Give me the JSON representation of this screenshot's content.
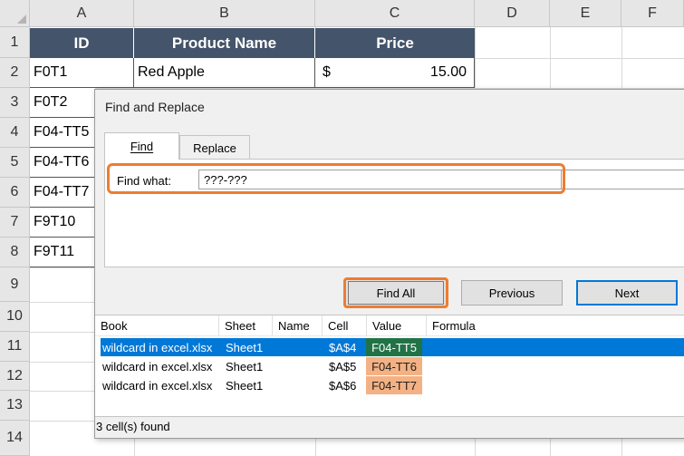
{
  "sheet": {
    "columns": [
      "A",
      "B",
      "C",
      "D",
      "E",
      "F"
    ],
    "rows": [
      "1",
      "2",
      "3",
      "4",
      "5",
      "6",
      "7",
      "8",
      "9",
      "10",
      "11",
      "12",
      "13",
      "14"
    ],
    "headers": {
      "id": "ID",
      "product": "Product Name",
      "price": "Price"
    },
    "row2": {
      "id": "F0T1",
      "product": "Red Apple",
      "currency": "$",
      "price": "15.00"
    },
    "ids": [
      "F0T2",
      "F04-TT5",
      "F04-TT6",
      "F04-TT7",
      "F9T10",
      "F9T11"
    ],
    "header_color": "#44546a"
  },
  "dialog": {
    "title": "Find and Replace",
    "tabs": {
      "find": "Find",
      "replace": "Replace"
    },
    "find_label": "Find what:",
    "find_value": "???-???",
    "buttons": {
      "find_all": "Find All",
      "previous": "Previous",
      "next": "Next"
    },
    "results": {
      "columns": [
        "Book",
        "Sheet",
        "Name",
        "Cell",
        "Value",
        "Formula"
      ],
      "rows": [
        {
          "book": "wildcard in excel.xlsx",
          "sheet": "Sheet1",
          "name": "",
          "cell": "$A$4",
          "value": "F04-TT5",
          "formula": ""
        },
        {
          "book": "wildcard in excel.xlsx",
          "sheet": "Sheet1",
          "name": "",
          "cell": "$A$5",
          "value": "F04-TT6",
          "formula": ""
        },
        {
          "book": "wildcard in excel.xlsx",
          "sheet": "Sheet1",
          "name": "",
          "cell": "$A$6",
          "value": "F04-TT7",
          "formula": ""
        }
      ]
    },
    "status": "3 cell(s) found",
    "highlight_color": "#ed7d31",
    "value_highlight": "#f4b183",
    "selected_value_highlight": "#217346",
    "selection_color": "#0078d7"
  }
}
